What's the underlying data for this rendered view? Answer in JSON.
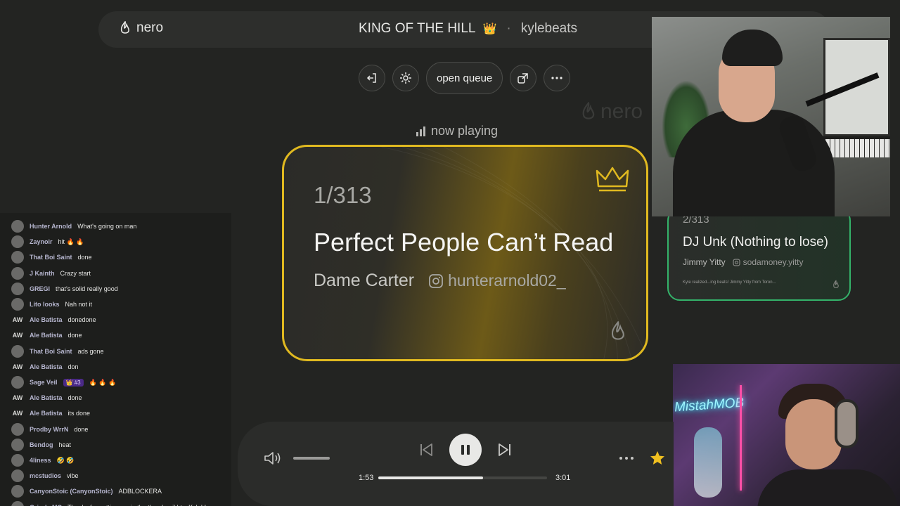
{
  "header": {
    "brand": "nero",
    "room_title": "KING OF THE HILL",
    "crown_emoji": "👑",
    "separator": "·",
    "host": "kylebeats"
  },
  "actions": {
    "open_queue_label": "open queue",
    "icons": [
      "exit-icon",
      "gear-icon",
      "share-icon",
      "more-icon"
    ]
  },
  "watermark": "nero",
  "now_playing": {
    "label": "now playing"
  },
  "current_card": {
    "count_current": "1",
    "count_total": "/313",
    "song": "Perfect People Can’t Read",
    "artist": "Dame Carter",
    "instagram": "hunterarnold02_",
    "accent": "#e0b920"
  },
  "next_card": {
    "count": "2/313",
    "song": "DJ Unk (Nothing to lose)",
    "artist": "Jimmy Yitty",
    "instagram": "sodamoney.yitty",
    "description": "Kyle realized...ing beats! Jimmy Yitty from Toron...",
    "accent": "#34b36a"
  },
  "chat": {
    "messages": [
      {
        "user": "Hunter Arnold",
        "text": "What's going on man",
        "avatar": "img"
      },
      {
        "user": "Zaynoir",
        "text": "hit 🔥 🔥",
        "avatar": "img"
      },
      {
        "user": "That Boi Saint",
        "text": "done",
        "avatar": "img"
      },
      {
        "user": "J Kainth",
        "text": "Crazy start",
        "avatar": "img"
      },
      {
        "user": "GREGI",
        "text": "that's solid really good",
        "avatar": "img"
      },
      {
        "user": "Lito looks",
        "text": "Nah not it",
        "avatar": "img"
      },
      {
        "user": "Ale Batista",
        "text": "donedone",
        "avatar": "AW"
      },
      {
        "user": "Ale Batista",
        "text": "done",
        "avatar": "AW"
      },
      {
        "user": "That Boi Saint",
        "text": "ads gone",
        "avatar": "img"
      },
      {
        "user": "Ale Batista",
        "text": "don",
        "avatar": "AW"
      },
      {
        "user": "Sage Veil",
        "badge": "👑 #3",
        "text": "🔥 🔥 🔥",
        "avatar": "img"
      },
      {
        "user": "Ale Batista",
        "text": "done",
        "avatar": "AW"
      },
      {
        "user": "Ale Batista",
        "text": "its done",
        "avatar": "AW"
      },
      {
        "user": "Prodby WrrN",
        "text": "done",
        "avatar": "img"
      },
      {
        "user": "Bendog",
        "text": "heat",
        "avatar": "img"
      },
      {
        "user": "4liness",
        "text": "🤣 🤣",
        "avatar": "img"
      },
      {
        "user": "mcstudios",
        "text": "vibe",
        "avatar": "img"
      },
      {
        "user": "CanyonStoic (CanyonStoic)",
        "text": "ADBLOCKERA",
        "avatar": "img"
      },
      {
        "user": "Grizzly MC",
        "text": "Thanks for putting me in the thumbnail btw Kyle! I",
        "avatar": "img"
      }
    ]
  },
  "webcam_overlays": {
    "neon_sign": "MistahMOB"
  },
  "player": {
    "time_current": "1:53",
    "time_total": "3:01",
    "progress": 0.62,
    "volume": 0.4,
    "favorite_color": "#f0c020"
  }
}
